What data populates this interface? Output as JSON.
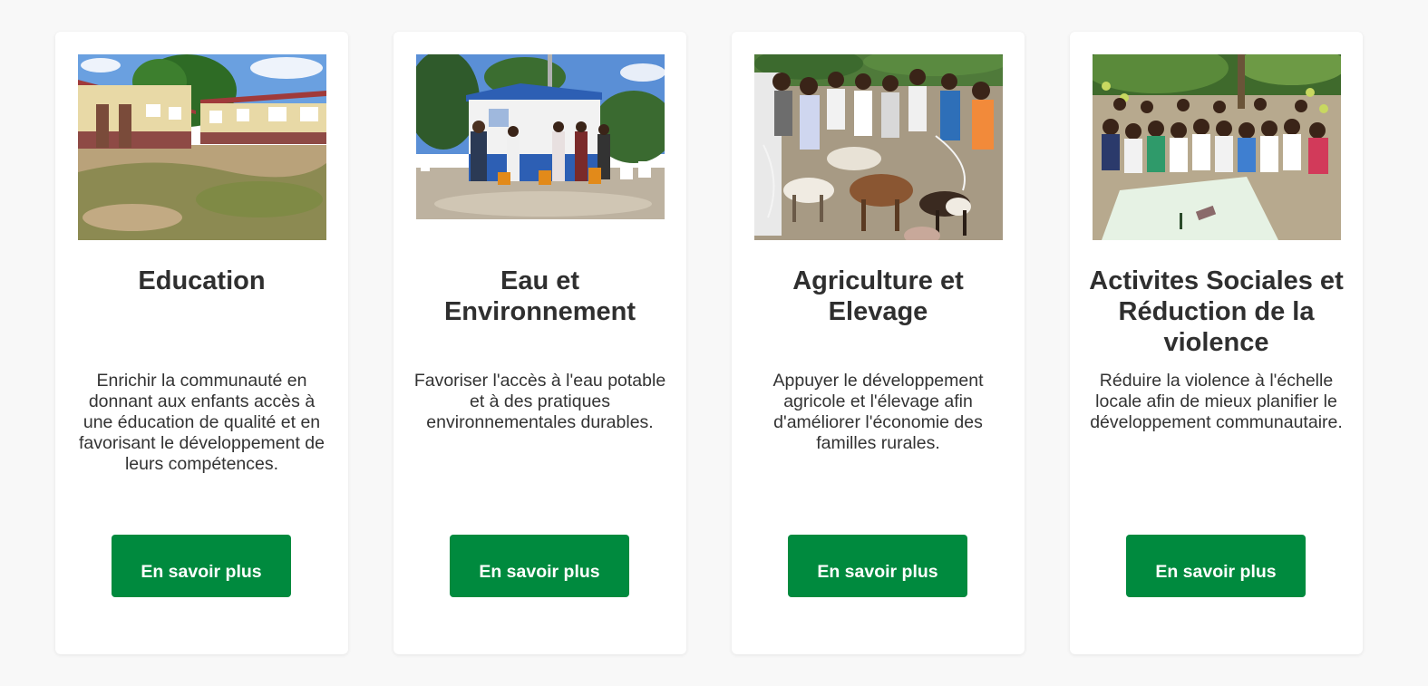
{
  "cards": [
    {
      "title": "Education",
      "description": "Enrichir la communauté en donnant aux enfants accès à une éducation de qualité et en favorisant le développement de leurs compétences.",
      "button_label": "En savoir plus",
      "image": "school-building-photo"
    },
    {
      "title": "Eau et Environnement",
      "description": "Favoriser l'accès à l'eau potable et à des pratiques environnementales durables.",
      "button_label": "En savoir plus",
      "image": "water-kiosk-photo"
    },
    {
      "title": "Agriculture et Elevage",
      "description": "Appuyer le développement agricole et l'élevage afin d'améliorer l'économie des familles rurales.",
      "button_label": "En savoir plus",
      "image": "goats-distribution-photo"
    },
    {
      "title": "Activites Sociales et Réduction de la violence",
      "description": "Réduire la violence à l'échelle locale afin de mieux planifier le développement communautaire.",
      "button_label": "En savoir plus",
      "image": "community-meeting-photo"
    }
  ],
  "colors": {
    "button": "#008a3e",
    "background": "#f8f8f8",
    "card": "#ffffff",
    "text": "#333333"
  }
}
